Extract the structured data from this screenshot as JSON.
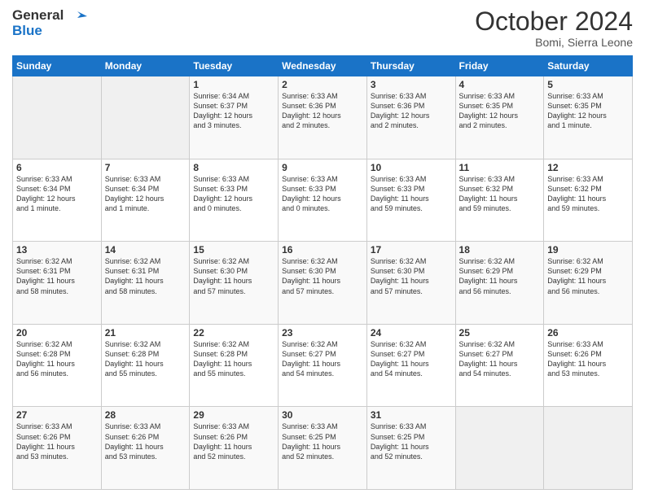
{
  "logo": {
    "line1": "General",
    "line2": "Blue"
  },
  "title": "October 2024",
  "location": "Bomi, Sierra Leone",
  "days_of_week": [
    "Sunday",
    "Monday",
    "Tuesday",
    "Wednesday",
    "Thursday",
    "Friday",
    "Saturday"
  ],
  "weeks": [
    [
      {
        "day": "",
        "info": ""
      },
      {
        "day": "",
        "info": ""
      },
      {
        "day": "1",
        "info": "Sunrise: 6:34 AM\nSunset: 6:37 PM\nDaylight: 12 hours\nand 3 minutes."
      },
      {
        "day": "2",
        "info": "Sunrise: 6:33 AM\nSunset: 6:36 PM\nDaylight: 12 hours\nand 2 minutes."
      },
      {
        "day": "3",
        "info": "Sunrise: 6:33 AM\nSunset: 6:36 PM\nDaylight: 12 hours\nand 2 minutes."
      },
      {
        "day": "4",
        "info": "Sunrise: 6:33 AM\nSunset: 6:35 PM\nDaylight: 12 hours\nand 2 minutes."
      },
      {
        "day": "5",
        "info": "Sunrise: 6:33 AM\nSunset: 6:35 PM\nDaylight: 12 hours\nand 1 minute."
      }
    ],
    [
      {
        "day": "6",
        "info": "Sunrise: 6:33 AM\nSunset: 6:34 PM\nDaylight: 12 hours\nand 1 minute."
      },
      {
        "day": "7",
        "info": "Sunrise: 6:33 AM\nSunset: 6:34 PM\nDaylight: 12 hours\nand 1 minute."
      },
      {
        "day": "8",
        "info": "Sunrise: 6:33 AM\nSunset: 6:33 PM\nDaylight: 12 hours\nand 0 minutes."
      },
      {
        "day": "9",
        "info": "Sunrise: 6:33 AM\nSunset: 6:33 PM\nDaylight: 12 hours\nand 0 minutes."
      },
      {
        "day": "10",
        "info": "Sunrise: 6:33 AM\nSunset: 6:33 PM\nDaylight: 11 hours\nand 59 minutes."
      },
      {
        "day": "11",
        "info": "Sunrise: 6:33 AM\nSunset: 6:32 PM\nDaylight: 11 hours\nand 59 minutes."
      },
      {
        "day": "12",
        "info": "Sunrise: 6:33 AM\nSunset: 6:32 PM\nDaylight: 11 hours\nand 59 minutes."
      }
    ],
    [
      {
        "day": "13",
        "info": "Sunrise: 6:32 AM\nSunset: 6:31 PM\nDaylight: 11 hours\nand 58 minutes."
      },
      {
        "day": "14",
        "info": "Sunrise: 6:32 AM\nSunset: 6:31 PM\nDaylight: 11 hours\nand 58 minutes."
      },
      {
        "day": "15",
        "info": "Sunrise: 6:32 AM\nSunset: 6:30 PM\nDaylight: 11 hours\nand 57 minutes."
      },
      {
        "day": "16",
        "info": "Sunrise: 6:32 AM\nSunset: 6:30 PM\nDaylight: 11 hours\nand 57 minutes."
      },
      {
        "day": "17",
        "info": "Sunrise: 6:32 AM\nSunset: 6:30 PM\nDaylight: 11 hours\nand 57 minutes."
      },
      {
        "day": "18",
        "info": "Sunrise: 6:32 AM\nSunset: 6:29 PM\nDaylight: 11 hours\nand 56 minutes."
      },
      {
        "day": "19",
        "info": "Sunrise: 6:32 AM\nSunset: 6:29 PM\nDaylight: 11 hours\nand 56 minutes."
      }
    ],
    [
      {
        "day": "20",
        "info": "Sunrise: 6:32 AM\nSunset: 6:28 PM\nDaylight: 11 hours\nand 56 minutes."
      },
      {
        "day": "21",
        "info": "Sunrise: 6:32 AM\nSunset: 6:28 PM\nDaylight: 11 hours\nand 55 minutes."
      },
      {
        "day": "22",
        "info": "Sunrise: 6:32 AM\nSunset: 6:28 PM\nDaylight: 11 hours\nand 55 minutes."
      },
      {
        "day": "23",
        "info": "Sunrise: 6:32 AM\nSunset: 6:27 PM\nDaylight: 11 hours\nand 54 minutes."
      },
      {
        "day": "24",
        "info": "Sunrise: 6:32 AM\nSunset: 6:27 PM\nDaylight: 11 hours\nand 54 minutes."
      },
      {
        "day": "25",
        "info": "Sunrise: 6:32 AM\nSunset: 6:27 PM\nDaylight: 11 hours\nand 54 minutes."
      },
      {
        "day": "26",
        "info": "Sunrise: 6:33 AM\nSunset: 6:26 PM\nDaylight: 11 hours\nand 53 minutes."
      }
    ],
    [
      {
        "day": "27",
        "info": "Sunrise: 6:33 AM\nSunset: 6:26 PM\nDaylight: 11 hours\nand 53 minutes."
      },
      {
        "day": "28",
        "info": "Sunrise: 6:33 AM\nSunset: 6:26 PM\nDaylight: 11 hours\nand 53 minutes."
      },
      {
        "day": "29",
        "info": "Sunrise: 6:33 AM\nSunset: 6:26 PM\nDaylight: 11 hours\nand 52 minutes."
      },
      {
        "day": "30",
        "info": "Sunrise: 6:33 AM\nSunset: 6:25 PM\nDaylight: 11 hours\nand 52 minutes."
      },
      {
        "day": "31",
        "info": "Sunrise: 6:33 AM\nSunset: 6:25 PM\nDaylight: 11 hours\nand 52 minutes."
      },
      {
        "day": "",
        "info": ""
      },
      {
        "day": "",
        "info": ""
      }
    ]
  ]
}
